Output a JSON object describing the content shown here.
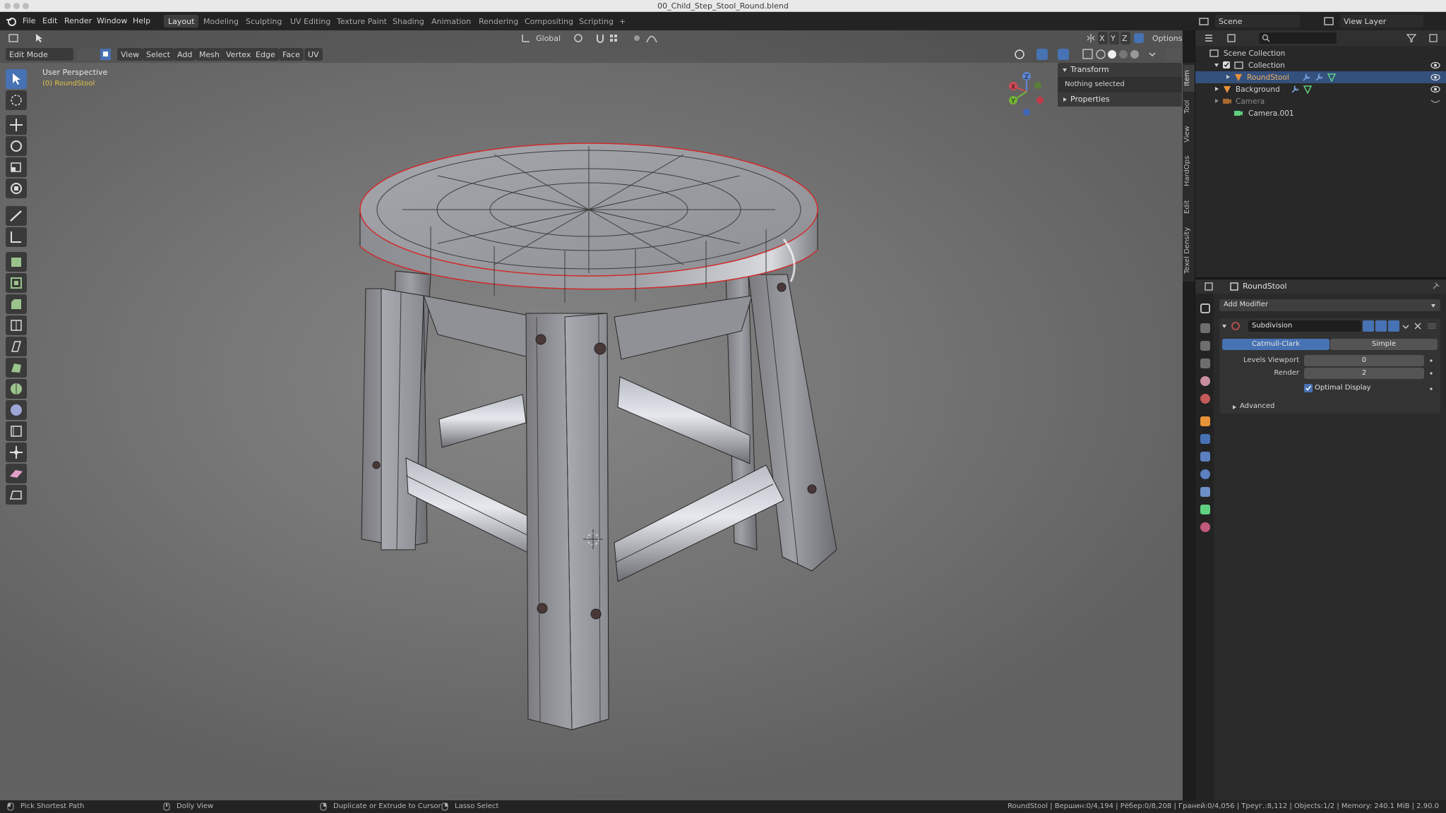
{
  "titlebar": {
    "title": "00_Child_Step_Stool_Round.blend"
  },
  "menu": [
    "File",
    "Edit",
    "Render",
    "Window",
    "Help"
  ],
  "workspaces": [
    "Layout",
    "Modeling",
    "Sculpting",
    "UV Editing",
    "Texture Paint",
    "Shading",
    "Animation",
    "Rendering",
    "Compositing",
    "Scripting",
    "+"
  ],
  "active_workspace": "Layout",
  "topright": {
    "scene": "Scene",
    "view_layer": "View Layer"
  },
  "header": {
    "transform_orientation": "Global",
    "axes": [
      "X",
      "Y",
      "Z"
    ],
    "options": "Options",
    "mode": "Edit Mode",
    "menus": [
      "View",
      "Select",
      "Add",
      "Mesh",
      "Vertex",
      "Edge",
      "Face",
      "UV"
    ]
  },
  "viewport": {
    "view_name": "User Perspective",
    "object_label": "(0) RoundStool"
  },
  "gizmo": {
    "z": "Z",
    "x": "X",
    "y": "Y"
  },
  "npanel": {
    "transform": "Transform",
    "nothing_selected": "Nothing selected",
    "properties": "Properties"
  },
  "side_tabs": [
    "Item",
    "Tool",
    "View",
    "HardOps",
    "Edit",
    "Texel Density"
  ],
  "outliner": {
    "rows": [
      {
        "label": "Scene Collection"
      },
      {
        "label": "Collection"
      },
      {
        "label": "RoundStool"
      },
      {
        "label": "Background"
      },
      {
        "label": "Camera"
      },
      {
        "label": "Camera.001"
      }
    ]
  },
  "properties": {
    "object": "RoundStool",
    "add_modifier": "Add Modifier",
    "modifier_name": "Subdivision",
    "catmull": "Catmull-Clark",
    "simple": "Simple",
    "levels_viewport_label": "Levels Viewport",
    "levels_viewport_value": "0",
    "render_label": "Render",
    "render_value": "2",
    "optimal_display": "Optimal Display",
    "advanced": "Advanced"
  },
  "status": {
    "pick": "Pick Shortest Path",
    "dolly": "Dolly View",
    "duplicate": "Duplicate or Extrude to Cursor",
    "lasso": "Lasso Select",
    "info": "RoundStool | Вершин:0/4,194 | Рёбер:0/8,208 | Граней:0/4,056 | Треуг.:8,112 | Objects:1/2 | Memory: 240.1 MiB | 2.90.0"
  },
  "colors": {
    "accent": "#4772b3",
    "selected_row": "#34507d",
    "object_label": "#e2c34a",
    "edge_seam": "#d02c2c"
  }
}
